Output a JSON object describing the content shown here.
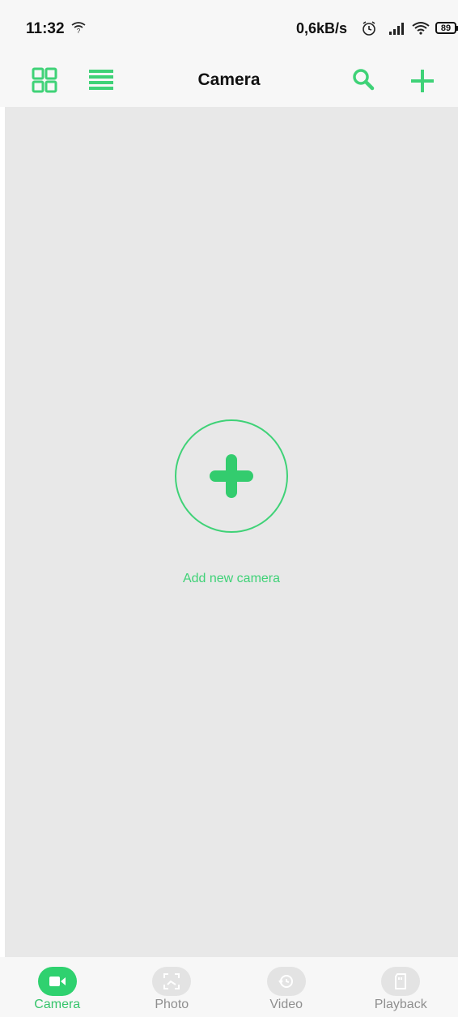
{
  "status_bar": {
    "time": "11:32",
    "network_speed": "0,6kB/s",
    "battery_level": "89",
    "icons": [
      "wifi-question-icon",
      "alarm-icon",
      "signal-icon",
      "wifi-icon",
      "battery-icon"
    ]
  },
  "app_bar": {
    "title": "Camera",
    "icons": [
      "grid-view-icon",
      "list-view-icon",
      "search-icon",
      "plus-icon"
    ]
  },
  "main": {
    "add_camera_label": "Add new camera",
    "icon": "plus-icon"
  },
  "tabs": [
    {
      "label": "Camera",
      "icon": "video-camera-icon",
      "active": true
    },
    {
      "label": "Photo",
      "icon": "photo-icon",
      "active": false
    },
    {
      "label": "Video",
      "icon": "video-history-icon",
      "active": false
    },
    {
      "label": "Playback",
      "icon": "sd-card-icon",
      "active": false
    }
  ],
  "colors": {
    "accent": "#3fd277",
    "content_background": "#e8e8e8",
    "bar_background": "#f7f7f7",
    "tab_inactive": "#8f8f8f",
    "tab_icon_inactive_bg": "#e3e3e3"
  }
}
